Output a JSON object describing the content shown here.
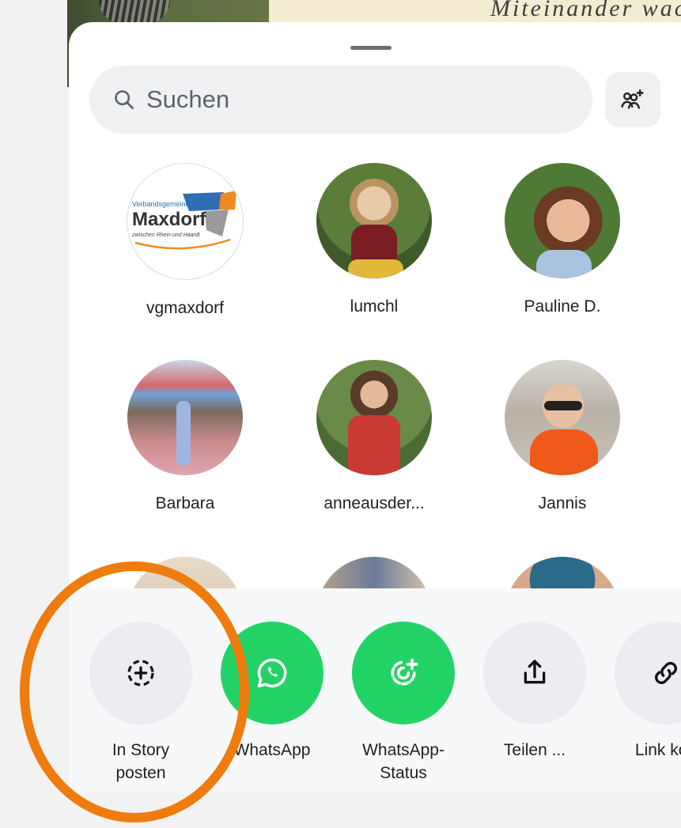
{
  "backdrop": {
    "caption": "Miteinander wachsen"
  },
  "search": {
    "placeholder": "Suchen"
  },
  "contacts": [
    {
      "name": "vgmaxdorf",
      "logo_line1": "Verbandsgemeinde",
      "logo_line2": "Maxdorf",
      "logo_line3": "zwischen Rhein und Haardt"
    },
    {
      "name": "lumchl"
    },
    {
      "name": "Pauline D."
    },
    {
      "name": "Barbara"
    },
    {
      "name": "anneausder..."
    },
    {
      "name": "Jannis"
    }
  ],
  "actions": [
    {
      "label": "In Story\nposten",
      "icon": "add-story-icon"
    },
    {
      "label": "WhatsApp",
      "icon": "whatsapp-icon"
    },
    {
      "label": "WhatsApp-\nStatus",
      "icon": "whatsapp-status-icon"
    },
    {
      "label": "Teilen ...",
      "icon": "share-icon"
    },
    {
      "label": "Link kop",
      "icon": "link-icon"
    }
  ],
  "colors": {
    "accent_green": "#24d366",
    "highlight_orange": "#ef7c0e",
    "surface": "#ffffff"
  }
}
